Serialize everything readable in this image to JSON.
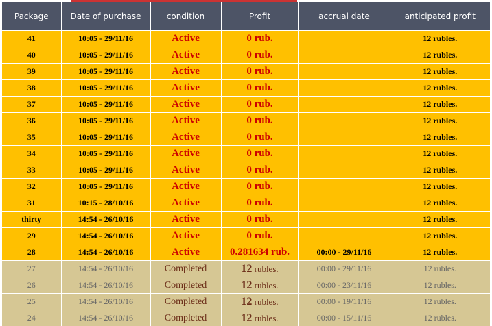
{
  "columns": [
    "Package",
    "Date of purchase",
    "condition",
    "Profit",
    "accrual date",
    "anticipated profit"
  ],
  "rows": [
    {
      "status": "active",
      "package": "41",
      "date": "10:05 - 29/11/16",
      "condition": "Active",
      "profit_num": "0",
      "profit_unit": "rub.",
      "accrual": "",
      "anticipated": "12 rubles."
    },
    {
      "status": "active",
      "package": "40",
      "date": "10:05 - 29/11/16",
      "condition": "Active",
      "profit_num": "0",
      "profit_unit": "rub.",
      "accrual": "",
      "anticipated": "12 rubles."
    },
    {
      "status": "active",
      "package": "39",
      "date": "10:05 - 29/11/16",
      "condition": "Active",
      "profit_num": "0",
      "profit_unit": "rub.",
      "accrual": "",
      "anticipated": "12 rubles."
    },
    {
      "status": "active",
      "package": "38",
      "date": "10:05 - 29/11/16",
      "condition": "Active",
      "profit_num": "0",
      "profit_unit": "rub.",
      "accrual": "",
      "anticipated": "12 rubles."
    },
    {
      "status": "active",
      "package": "37",
      "date": "10:05 - 29/11/16",
      "condition": "Active",
      "profit_num": "0",
      "profit_unit": "rub.",
      "accrual": "",
      "anticipated": "12 rubles."
    },
    {
      "status": "active",
      "package": "36",
      "date": "10:05 - 29/11/16",
      "condition": "Active",
      "profit_num": "0",
      "profit_unit": "rub.",
      "accrual": "",
      "anticipated": "12 rubles."
    },
    {
      "status": "active",
      "package": "35",
      "date": "10:05 - 29/11/16",
      "condition": "Active",
      "profit_num": "0",
      "profit_unit": "rub.",
      "accrual": "",
      "anticipated": "12 rubles."
    },
    {
      "status": "active",
      "package": "34",
      "date": "10:05 - 29/11/16",
      "condition": "Active",
      "profit_num": "0",
      "profit_unit": "rub.",
      "accrual": "",
      "anticipated": "12 rubles."
    },
    {
      "status": "active",
      "package": "33",
      "date": "10:05 - 29/11/16",
      "condition": "Active",
      "profit_num": "0",
      "profit_unit": "rub.",
      "accrual": "",
      "anticipated": "12 rubles."
    },
    {
      "status": "active",
      "package": "32",
      "date": "10:05 - 29/11/16",
      "condition": "Active",
      "profit_num": "0",
      "profit_unit": "rub.",
      "accrual": "",
      "anticipated": "12 rubles."
    },
    {
      "status": "active",
      "package": "31",
      "date": "10:15 - 28/10/16",
      "condition": "Active",
      "profit_num": "0",
      "profit_unit": "rub.",
      "accrual": "",
      "anticipated": "12 rubles."
    },
    {
      "status": "active",
      "package": "thirty",
      "date": "14:54 - 26/10/16",
      "condition": "Active",
      "profit_num": "0",
      "profit_unit": "rub.",
      "accrual": "",
      "anticipated": "12 rubles."
    },
    {
      "status": "active",
      "package": "29",
      "date": "14:54 - 26/10/16",
      "condition": "Active",
      "profit_num": "0",
      "profit_unit": "rub.",
      "accrual": "",
      "anticipated": "12 rubles."
    },
    {
      "status": "active",
      "package": "28",
      "date": "14:54 - 26/10/16",
      "condition": "Active",
      "profit_num": "0.281634",
      "profit_unit": "rub.",
      "accrual": "00:00 - 29/11/16",
      "anticipated": "12 rubles."
    },
    {
      "status": "done",
      "package": "27",
      "date": "14:54 - 26/10/16",
      "condition": "Completed",
      "profit_num": "12",
      "profit_unit": "rubles.",
      "accrual": "00:00 - 29/11/16",
      "anticipated": "12 rubles."
    },
    {
      "status": "done",
      "package": "26",
      "date": "14:54 - 26/10/16",
      "condition": "Completed",
      "profit_num": "12",
      "profit_unit": "rubles.",
      "accrual": "00:00 - 23/11/16",
      "anticipated": "12 rubles."
    },
    {
      "status": "done",
      "package": "25",
      "date": "14:54 - 26/10/16",
      "condition": "Completed",
      "profit_num": "12",
      "profit_unit": "rubles.",
      "accrual": "00:00 - 19/11/16",
      "anticipated": "12 rubles."
    },
    {
      "status": "done",
      "package": "24",
      "date": "14:54 - 26/10/16",
      "condition": "Completed",
      "profit_num": "12",
      "profit_unit": "rubles.",
      "accrual": "00:00 - 15/11/16",
      "anticipated": "12 rubles."
    }
  ],
  "colors": {
    "header_bg": "#4d5466",
    "active_row_bg": "#ffc000",
    "completed_row_bg": "#d6c794",
    "active_status_text": "#cc0000",
    "completed_status_text": "#6b2d18"
  }
}
